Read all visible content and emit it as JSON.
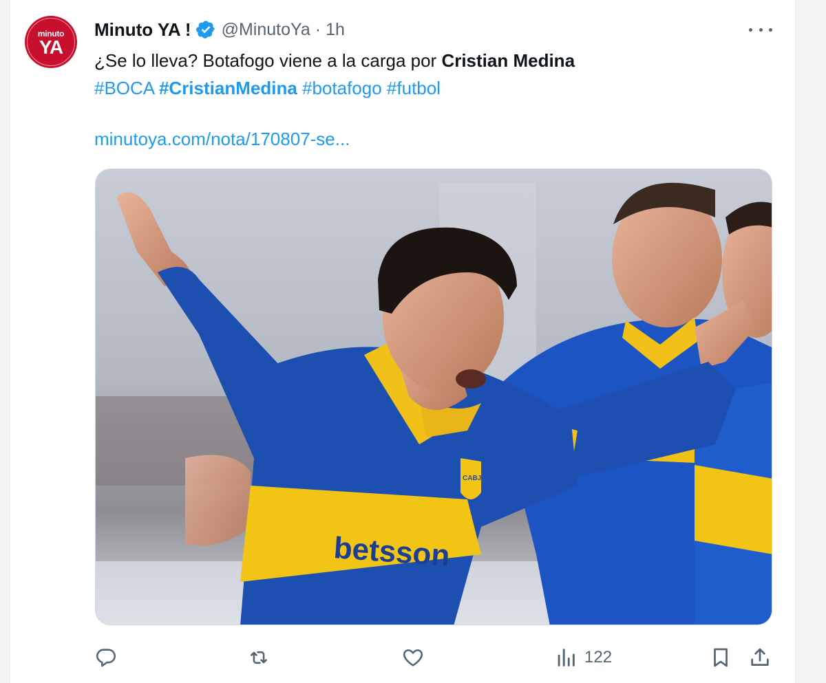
{
  "tweet": {
    "avatar_text_top": "minuto",
    "avatar_text_bottom": "YA",
    "display_name": "Minuto YA !",
    "handle": "@MinutoYa",
    "separator": "·",
    "time": "1h",
    "text_lead": "¿Se lo lleva? Botafogo viene a la carga por ",
    "text_bold": "Cristian Medina",
    "hashtags": [
      "#BOCA",
      "#CristianMedina",
      "#botafogo",
      "#futbol"
    ],
    "link": "minutoya.com/nota/170807-se...",
    "media_jersey_sponsor": "betsson",
    "media_jersey_crest": "CABJ"
  },
  "actions": {
    "views_count": "122"
  },
  "icons": {
    "more": "more-dots-icon",
    "verified": "verified-badge-icon",
    "reply": "reply-icon",
    "retweet": "retweet-icon",
    "like": "heart-icon",
    "views": "views-chart-icon",
    "bookmark": "bookmark-icon",
    "share": "share-icon"
  },
  "colors": {
    "accent": "#1d9bf0",
    "text": "#0f1419",
    "muted": "#536471",
    "avatar_bg": "#c8102e",
    "boca_blue": "#1d4fb0",
    "boca_gold": "#f2c416"
  }
}
